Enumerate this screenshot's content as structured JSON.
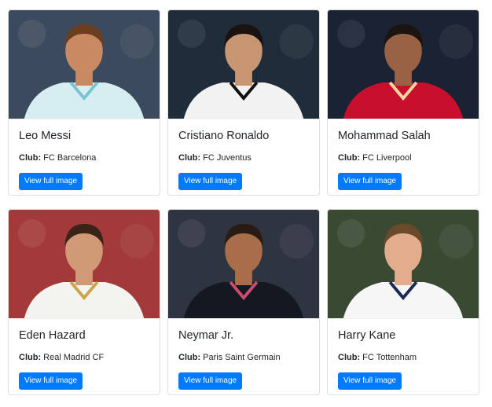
{
  "club_label": "Club:",
  "cards": [
    {
      "name": "Leo Messi",
      "club": "FC Barcelona",
      "button": "View full image",
      "colors": {
        "bg": "#3b4a5d",
        "skin": "#c98a63",
        "hair": "#6b3e1d",
        "shirt": "#d6eef2",
        "accent": "#79c3d3"
      }
    },
    {
      "name": "Cristiano Ronaldo",
      "club": "FC Juventus",
      "button": "View full image",
      "colors": {
        "bg": "#1f2d3a",
        "skin": "#c79773",
        "hair": "#1a1210",
        "shirt": "#f2f2f2",
        "accent": "#111111"
      }
    },
    {
      "name": "Mohammad Salah",
      "club": "FC Liverpool",
      "button": "View full image",
      "colors": {
        "bg": "#1a2233",
        "skin": "#9a6244",
        "hair": "#1c1410",
        "shirt": "#c8102e",
        "accent": "#f0d7a0"
      }
    },
    {
      "name": "Eden Hazard",
      "club": "Real Madrid CF",
      "button": "View full image",
      "colors": {
        "bg": "#a23a3a",
        "skin": "#d19a77",
        "hair": "#3a2418",
        "shirt": "#f3f3f0",
        "accent": "#c9a64a"
      }
    },
    {
      "name": "Neymar Jr.",
      "club": "Paris Saint Germain",
      "button": "View full image",
      "colors": {
        "bg": "#2e3440",
        "skin": "#a86e4a",
        "hair": "#2a1c12",
        "shirt": "#141821",
        "accent": "#d04a6e"
      }
    },
    {
      "name": "Harry Kane",
      "club": "FC Tottenham",
      "button": "View full image",
      "colors": {
        "bg": "#3a4a32",
        "skin": "#e2ac8d",
        "hair": "#6b4a2c",
        "shirt": "#f6f6f6",
        "accent": "#1b2a55"
      }
    }
  ]
}
